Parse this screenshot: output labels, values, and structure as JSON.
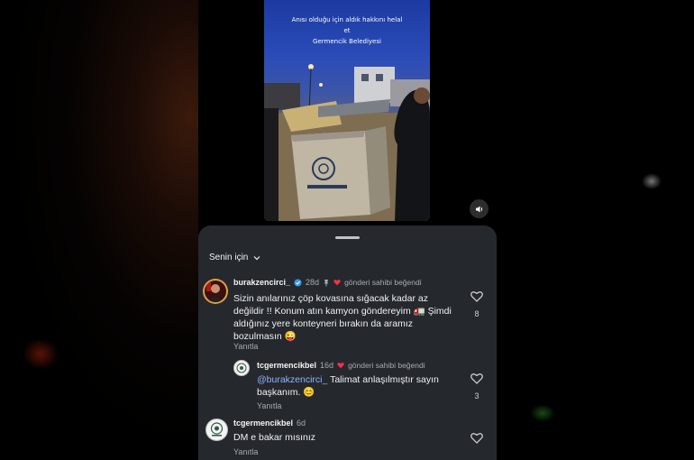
{
  "video": {
    "overlay_lines": [
      "Anısı olduğu için aldık hakkını helal",
      "et",
      "Germencik Belediyesi"
    ]
  },
  "sheet": {
    "filter_label": "Senin için"
  },
  "comments": [
    {
      "username": "burakzencirci_",
      "time": "28d",
      "liked_text": "gönderi sahibi beğendi",
      "text": "Sizin anılarınız çöp kovasına sığacak kadar az değildir !! Konum atın kamyon göndereyim 🚛 Şimdi aldığınız yere konteyneri bırakın da aramız bozulmasın 😜",
      "reply_label": "Yanıtla",
      "like_count": "8"
    },
    {
      "username": "tcgermencikbel",
      "time": "16d",
      "liked_text": "gönderi sahibi beğendi",
      "mention": "@burakzencirci_",
      "text": " Talimat anlaşılmıştır sayın başkanım. 😊",
      "reply_label": "Yanıtla",
      "like_count": "3"
    },
    {
      "username": "tcgermencikbel",
      "time": "6d",
      "text": "DM e bakar mısınız",
      "reply_label": "Yanıtla"
    }
  ],
  "colors": {
    "sheet_bg": "#25292e",
    "heart_red": "#ff3040",
    "verified_blue": "#3897f0",
    "mention_blue": "#8fb4ff"
  }
}
